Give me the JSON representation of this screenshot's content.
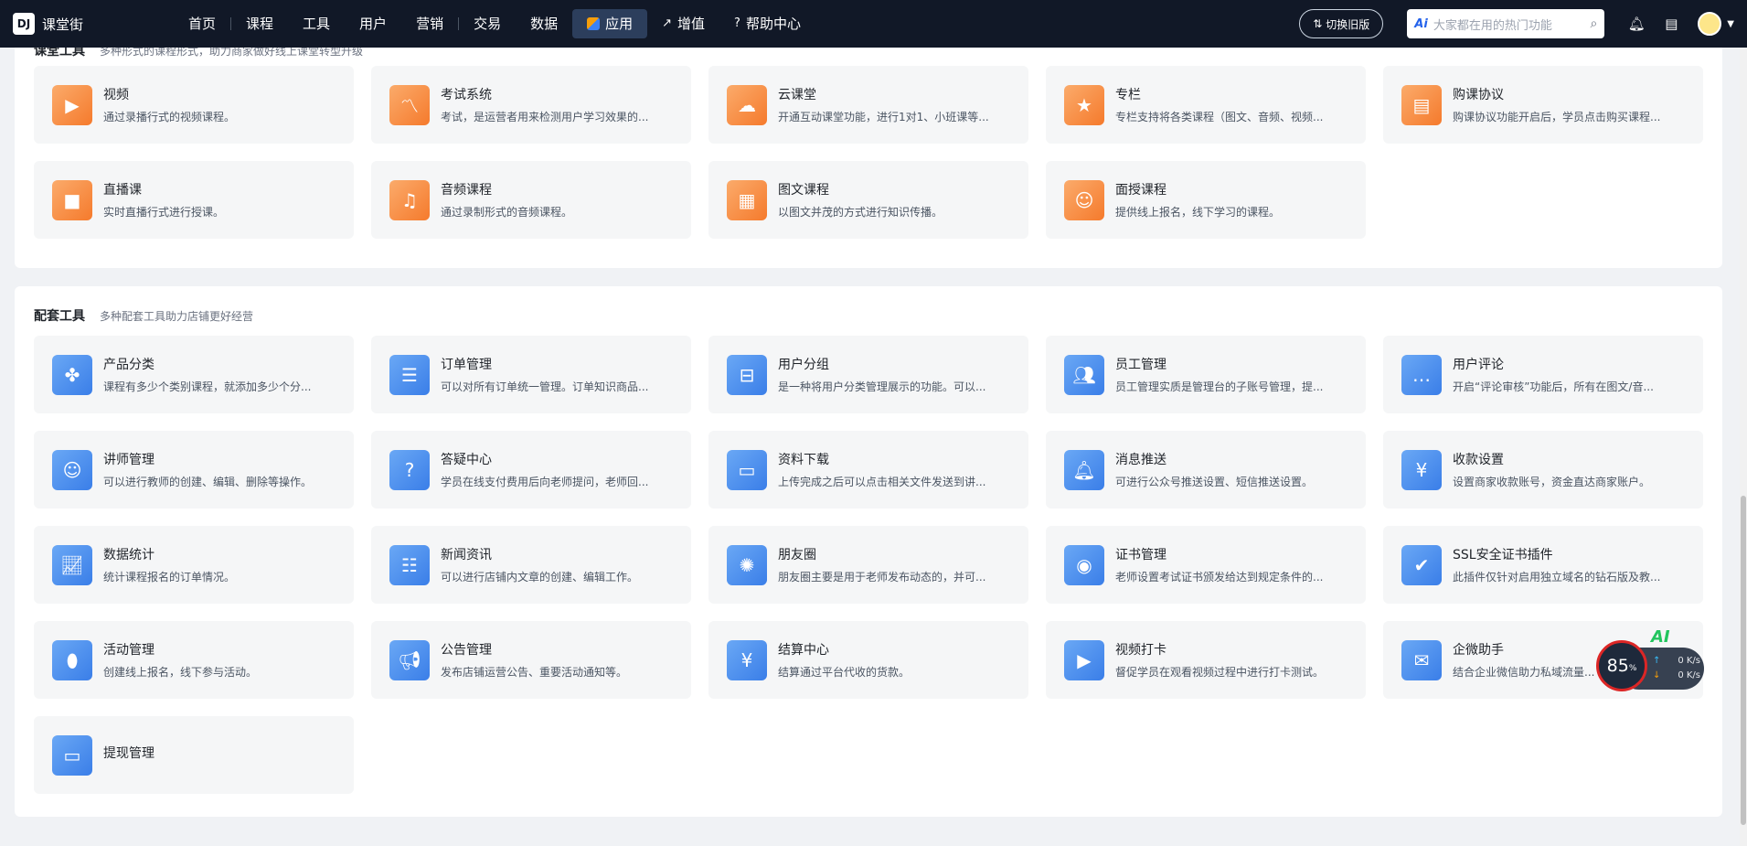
{
  "header": {
    "logo_text": "课堂街",
    "nav": [
      "首页",
      "课程",
      "工具",
      "用户",
      "营销",
      "交易",
      "数据"
    ],
    "nav_active": "应用",
    "nav_extra": [
      "增值",
      "帮助中心"
    ],
    "switch_label": "切换旧版",
    "search_badge": "Ai",
    "search_placeholder": "大家都在用的热门功能"
  },
  "sections": {
    "course": {
      "title": "课堂工具",
      "desc": "多种形式的课程形式，助力商家做好线上课堂转型升级",
      "cards": [
        {
          "name": "视频",
          "desc": "通过录播行式的视频课程。"
        },
        {
          "name": "考试系统",
          "desc": "考试，是运营者用来检测用户学习效果的..."
        },
        {
          "name": "云课堂",
          "desc": "开通互动课堂功能，进行1对1、小班课等..."
        },
        {
          "name": "专栏",
          "desc": "专栏支持将各类课程（图文、音频、视频..."
        },
        {
          "name": "购课协议",
          "desc": "购课协议功能开启后，学员点击购买课程..."
        },
        {
          "name": "直播课",
          "desc": "实时直播行式进行授课。"
        },
        {
          "name": "音频课程",
          "desc": "通过录制形式的音频课程。"
        },
        {
          "name": "图文课程",
          "desc": "以图文并茂的方式进行知识传播。"
        },
        {
          "name": "面授课程",
          "desc": "提供线上报名，线下学习的课程。"
        }
      ]
    },
    "support": {
      "title": "配套工具",
      "desc": "多种配套工具助力店铺更好经营",
      "cards": [
        {
          "name": "产品分类",
          "desc": "课程有多少个类别课程，就添加多少个分..."
        },
        {
          "name": "订单管理",
          "desc": "可以对所有订单统一管理。订单知识商品..."
        },
        {
          "name": "用户分组",
          "desc": "是一种将用户分类管理展示的功能。可以..."
        },
        {
          "name": "员工管理",
          "desc": "员工管理实质是管理台的子账号管理，提..."
        },
        {
          "name": "用户评论",
          "desc": "开启“评论审核”功能后，所有在图文/音..."
        },
        {
          "name": "讲师管理",
          "desc": "可以进行教师的创建、编辑、删除等操作。"
        },
        {
          "name": "答疑中心",
          "desc": "学员在线支付费用后向老师提问，老师回..."
        },
        {
          "name": "资料下载",
          "desc": "上传完成之后可以点击相关文件发送到讲..."
        },
        {
          "name": "消息推送",
          "desc": "可进行公众号推送设置、短信推送设置。"
        },
        {
          "name": "收款设置",
          "desc": "设置商家收款账号，资金直达商家账户。"
        },
        {
          "name": "数据统计",
          "desc": "统计课程报名的订单情况。"
        },
        {
          "name": "新闻资讯",
          "desc": "可以进行店铺内文章的创建、编辑工作。"
        },
        {
          "name": "朋友圈",
          "desc": "朋友圈主要是用于老师发布动态的，并可..."
        },
        {
          "name": "证书管理",
          "desc": "老师设置考试证书颁发给达到规定条件的..."
        },
        {
          "name": "SSL安全证书插件",
          "desc": "此插件仅针对启用独立域名的钻石版及教..."
        },
        {
          "name": "活动管理",
          "desc": "创建线上报名，线下参与活动。"
        },
        {
          "name": "公告管理",
          "desc": "发布店铺运营公告、重要活动通知等。"
        },
        {
          "name": "结算中心",
          "desc": "结算通过平台代收的货款。"
        },
        {
          "name": "视频打卡",
          "desc": "督促学员在观看视频过程中进行打卡测试。"
        },
        {
          "name": "企微助手",
          "desc": "结合企业微信助力私域流量..."
        },
        {
          "name": "提现管理",
          "desc": ""
        }
      ]
    }
  },
  "monitor": {
    "ai": "AI",
    "percent": "85",
    "unit": "%",
    "up": "0 K/s",
    "down": "0 K/s"
  },
  "colors": {
    "topbar": "#111827",
    "orange_icon": "#f57a2c",
    "blue_icon": "#3a7ee8",
    "card_bg": "#f5f6f7"
  }
}
